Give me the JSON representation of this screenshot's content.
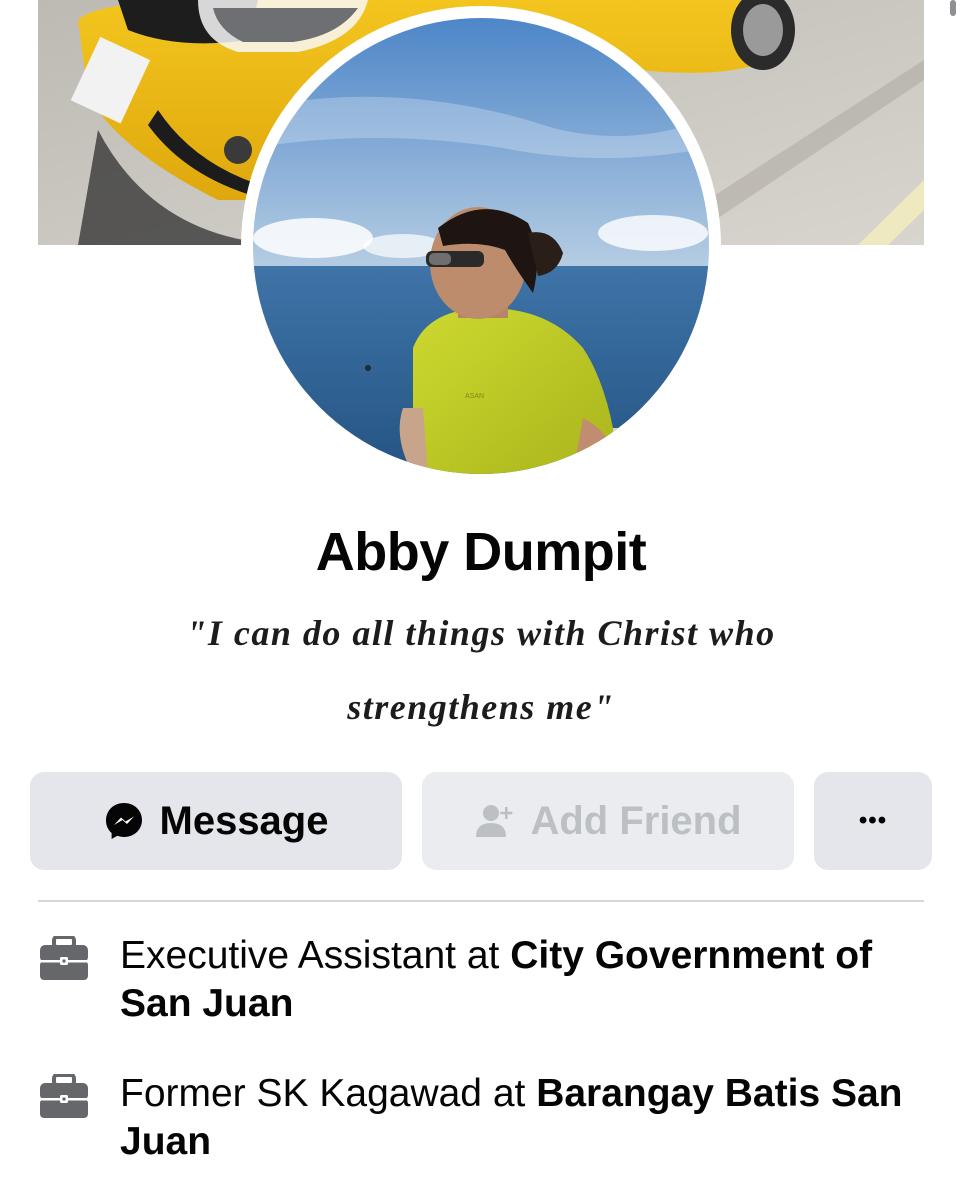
{
  "profile": {
    "name": "Abby Dumpit",
    "bio": "\"I can do all things with Christ who strengthens me\""
  },
  "actions": {
    "message_label": "Message",
    "add_friend_label": "Add Friend",
    "more_label": "•••"
  },
  "intro": {
    "items": [
      {
        "icon": "briefcase-icon",
        "role": "Executive Assistant at ",
        "org": "City Government of San Juan"
      },
      {
        "icon": "briefcase-icon",
        "role": "Former SK Kagawad at ",
        "org": "Barangay Batis San Juan"
      }
    ]
  },
  "colors": {
    "button_bg": "#e4e6eb",
    "disabled_text": "#bcc0c4",
    "text": "#050505"
  }
}
